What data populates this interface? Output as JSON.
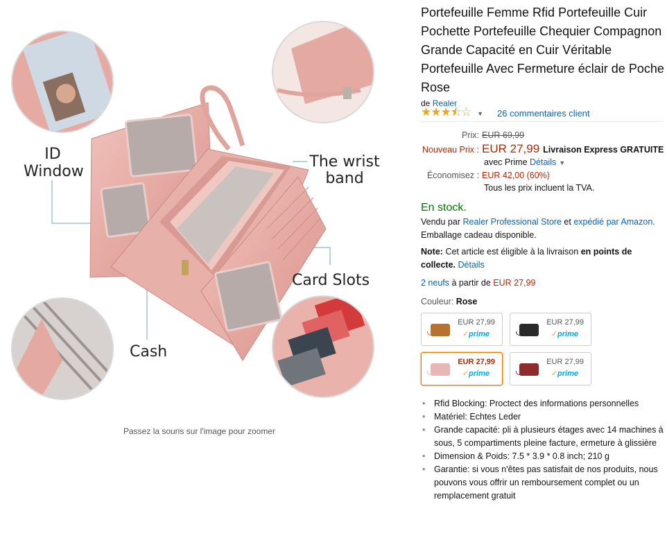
{
  "image": {
    "zoom_hint": "Passez la souris sur l'image pour zoomer",
    "callouts": {
      "id_window": "ID Window",
      "wrist_band": "The wrist band",
      "card_slots": "Card Slots",
      "cash": "Cash"
    }
  },
  "product": {
    "title": "Portefeuille Femme Rfid Portefeuille Cuir Pochette Portefeuille Chequier Compagnon Grande Capacité en Cuir Véritable Portefeuille Avec Fermeture éclair de Poche Rose",
    "brand_prefix": "de",
    "brand": "Realer",
    "rating_stars": 3.5,
    "rating_glyphs": "★★★⯪☆",
    "reviews": "26 commentaires client"
  },
  "price": {
    "list_label": "Prix:",
    "list_value": "EUR 69,99",
    "new_label": "Nouveau Prix :",
    "new_value": "EUR 27,99",
    "shipping": "Livraison Express GRATUITE",
    "prime_prefix": "avec Prime",
    "prime_details": "Détails",
    "save_label": "Économisez :",
    "save_value": "EUR 42,00 (60%)",
    "tax_note": "Tous les prix incluent la TVA."
  },
  "availability": {
    "stock": "En stock.",
    "sold_by_prefix": "Vendu par",
    "seller": "Realer Professional Store",
    "and": "et",
    "shipped_by": "expédié par Amazon.",
    "gift": "Emballage cadeau disponible.",
    "note_label": "Note:",
    "note_text": "Cet article est éligible à la livraison",
    "note_bold": "en points de collecte.",
    "note_link": "Détails"
  },
  "offers": {
    "count_link": "2 neufs",
    "from": "à partir de",
    "price": "EUR 27,99"
  },
  "color": {
    "label": "Couleur:",
    "selected": "Rose",
    "options": [
      {
        "price": "EUR 27,99",
        "prime": "prime",
        "color": "#b8722f"
      },
      {
        "price": "EUR 27,99",
        "prime": "prime",
        "color": "#2a2a2a"
      },
      {
        "price": "EUR 27,99",
        "prime": "prime",
        "color": "#e9b7b3"
      },
      {
        "price": "EUR 27,99",
        "prime": "prime",
        "color": "#8e2b2b"
      }
    ]
  },
  "bullets": [
    "Rfid Blocking: Proctect des informations personnelles",
    "Matériel: Echtes Leder",
    "Grande capacité: pli à plusieurs étages avec 14 machines à sous, 5 compartiments pleine facture, ermeture à glissière",
    "Dimension & Poids: 7.5 * 3.9 * 0.8 inch; 210 g",
    "Garantie: si vous n'êtes pas satisfait de nos produits, nous pouvons vous offrir un remboursement complet ou un remplacement gratuit"
  ],
  "colors": {
    "link": "#0066c0",
    "price_red": "#b12704",
    "stock_green": "#007600",
    "star_gold": "#f0a41c",
    "selected_border": "#e77600",
    "wallet_pink": "#e4a9a1"
  }
}
